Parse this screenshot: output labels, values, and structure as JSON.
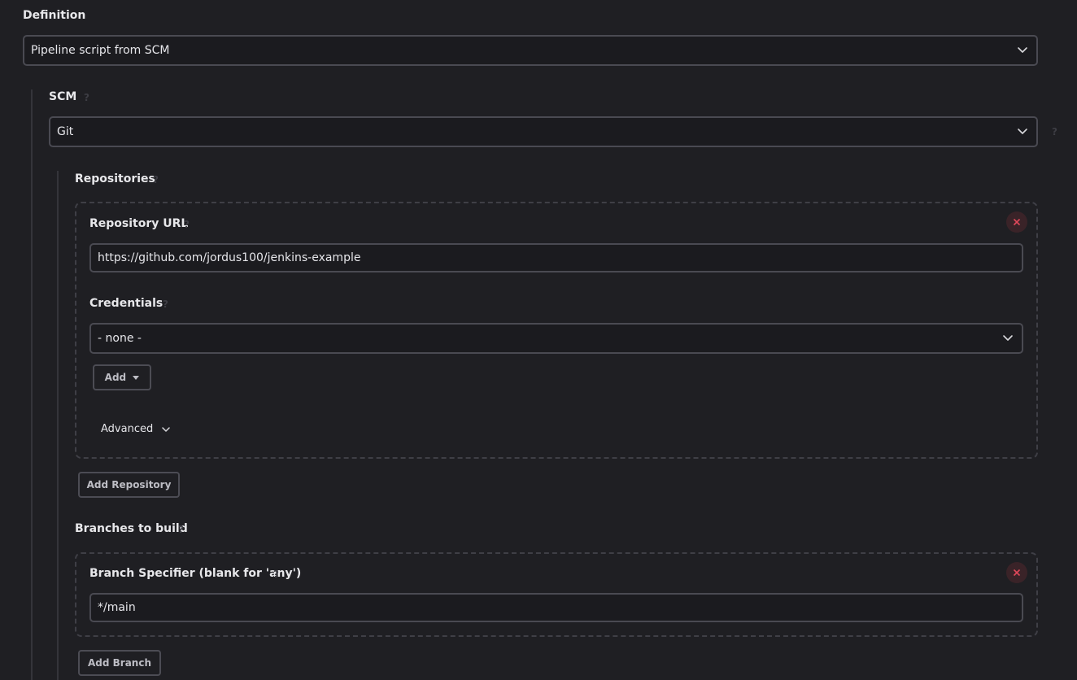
{
  "definition": {
    "label": "Definition",
    "selected": "Pipeline script from SCM"
  },
  "scm": {
    "label": "SCM",
    "selected": "Git"
  },
  "repositories": {
    "label": "Repositories",
    "repo_url_label": "Repository URL",
    "repo_url_value": "https://github.com/jordus100/jenkins-example",
    "credentials_label": "Credentials",
    "credentials_selected": "- none -",
    "add_label": "Add",
    "advanced_label": "Advanced",
    "add_repository_label": "Add Repository"
  },
  "branches": {
    "label": "Branches to build",
    "specifier_label": "Branch Specifier (blank for 'any')",
    "specifier_value": "*/main",
    "add_branch_label": "Add Branch"
  },
  "colors": {
    "background": "#1f1f23",
    "field_border": "#4a4a52",
    "close_icon": "#e0485a"
  },
  "icons": [
    "help-icon",
    "chevron-down-icon",
    "close-icon",
    "caret-down-icon"
  ]
}
